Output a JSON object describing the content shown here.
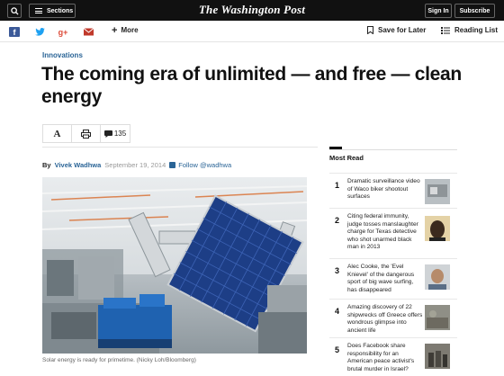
{
  "topbar": {
    "sections_label": "Sections",
    "masthead": "The Washington Post",
    "signin_label": "Sign In",
    "subscribe_label": "Subscribe"
  },
  "sharebar": {
    "more_label": "More",
    "save_label": "Save for Later",
    "reading_list_label": "Reading List"
  },
  "article": {
    "kicker": "Innovations",
    "headline": "The coming era of unlimited — and free — clean energy",
    "comment_count": "135",
    "byline_prefix": "By",
    "author": "Vivek Wadhwa",
    "date": "September 19, 2014",
    "follow_label": "Follow @wadhwa",
    "caption": "Solar energy is ready for primetime. (Nicky Loh/Bloomberg)"
  },
  "most_read": {
    "title": "Most Read",
    "items": [
      {
        "num": "1",
        "text": "Dramatic surveillance video of Waco biker shootout surfaces"
      },
      {
        "num": "2",
        "text": "Citing federal immunity, judge tosses manslaughter charge for Texas detective who shot unarmed black man in 2013"
      },
      {
        "num": "3",
        "text": "Alec Cooke, the 'Evel Knievel' of the dangerous sport of big wave surfing, has disappeared"
      },
      {
        "num": "4",
        "text": "Amazing discovery of 22 shipwrecks off Greece offers wondrous glimpse into ancient life"
      },
      {
        "num": "5",
        "text": "Does Facebook share responsibility for an American peace activist's brutal murder in Israel?"
      }
    ]
  },
  "colors": {
    "topbar": "#111111",
    "link_blue": "#2a6496",
    "facebook": "#3b5998",
    "twitter": "#1da1f2",
    "google": "#dd4b39",
    "email": "#c0392b"
  }
}
